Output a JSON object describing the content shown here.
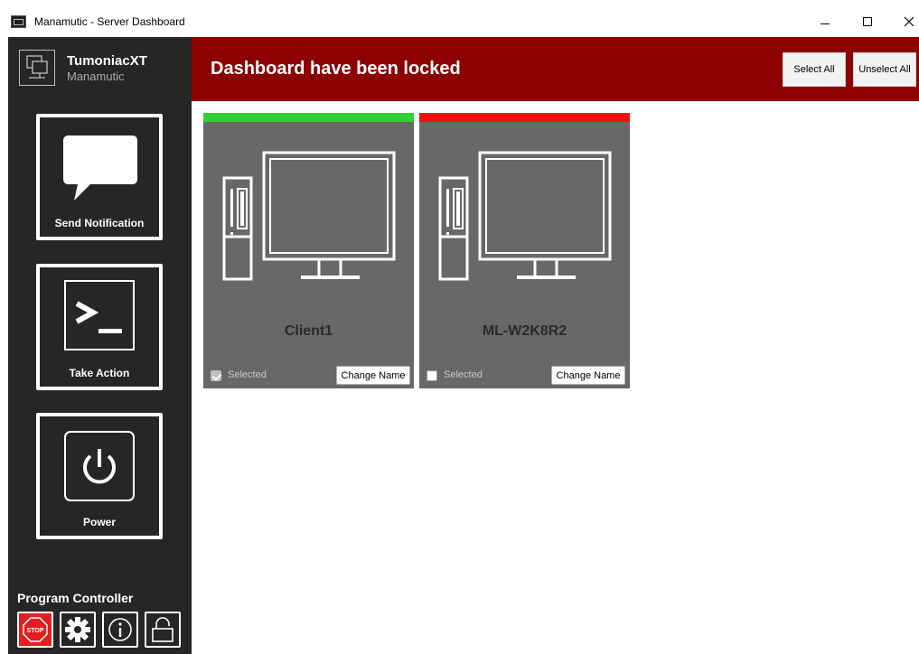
{
  "window": {
    "title": "Manamutic - Server Dashboard"
  },
  "brand": {
    "name": "TumoniacXT",
    "subtitle": "Manamutic"
  },
  "sidebar": {
    "buttons": [
      {
        "label": "Send Notification",
        "icon": "chat-bubble-icon"
      },
      {
        "label": "Take Action",
        "icon": "terminal-icon"
      },
      {
        "label": "Power",
        "icon": "power-icon"
      }
    ],
    "program_controller": {
      "title": "Program Controller",
      "buttons": [
        {
          "icon": "stop-icon",
          "text": "STOP",
          "color": "#e02020"
        },
        {
          "icon": "gear-icon"
        },
        {
          "icon": "info-icon"
        },
        {
          "icon": "unlock-icon"
        }
      ]
    }
  },
  "header": {
    "title": "Dashboard have been locked",
    "background": "#8c0000",
    "select_all_label": "Select All",
    "unselect_all_label": "Unselect All"
  },
  "clients": [
    {
      "name": "Client1",
      "status_color": "#33cc33",
      "selected_label": "Selected",
      "selected": true,
      "change_name_label": "Change Name"
    },
    {
      "name": "ML-W2K8R2",
      "status_color": "#ee1111",
      "selected_label": "Selected",
      "selected": false,
      "change_name_label": "Change Name"
    }
  ]
}
